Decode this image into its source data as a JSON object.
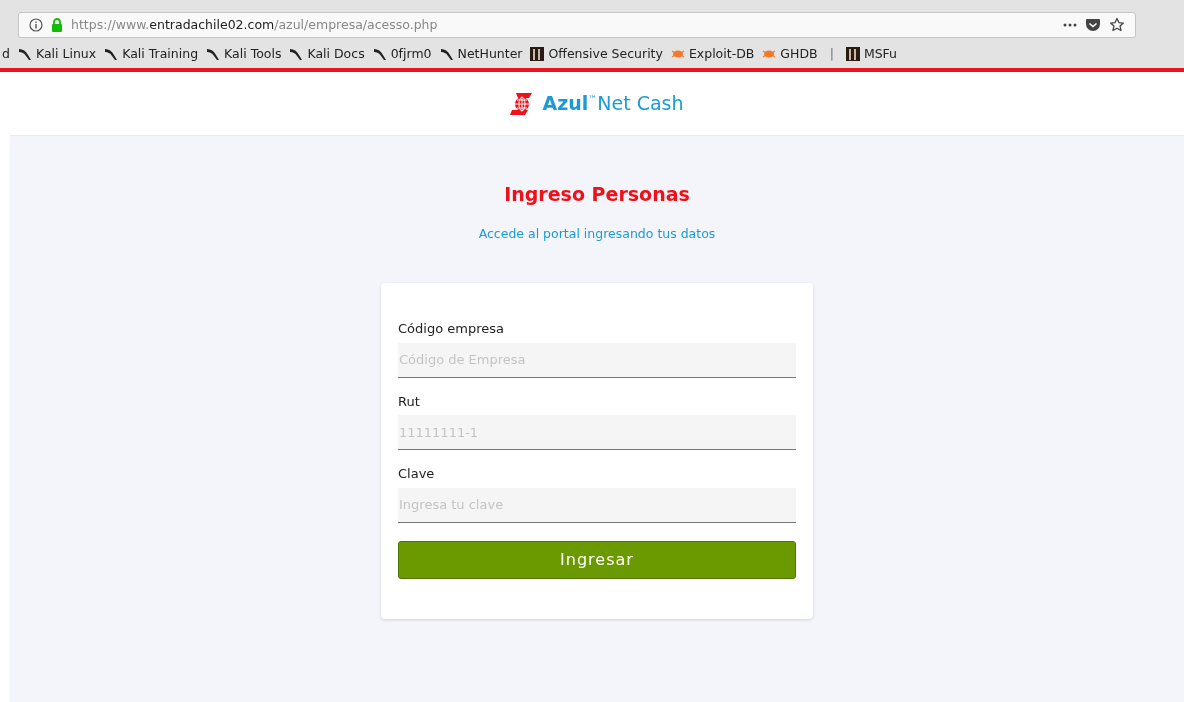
{
  "browser": {
    "url_prefix": "https://www.",
    "url_domain": "entradachile02.com",
    "url_path": "/azul/empresa/acesso.php",
    "bookmarks": [
      {
        "kind": "plain",
        "label": "d"
      },
      {
        "kind": "kali",
        "label": "Kali Linux"
      },
      {
        "kind": "kali",
        "label": "Kali Training"
      },
      {
        "kind": "kali",
        "label": "Kali Tools"
      },
      {
        "kind": "kali",
        "label": "Kali Docs"
      },
      {
        "kind": "kali",
        "label": "0fjrm0"
      },
      {
        "kind": "kali",
        "label": "NetHunter"
      },
      {
        "kind": "offsec",
        "label": "Offensive Security"
      },
      {
        "kind": "exploit",
        "label": "Exploit-DB"
      },
      {
        "kind": "exploit",
        "label": "GHDB"
      },
      {
        "kind": "separator",
        "label": "|"
      },
      {
        "kind": "offsec",
        "label": "MSFu"
      }
    ]
  },
  "header": {
    "brand": "Azul",
    "trademark": "™",
    "product": "Net Cash"
  },
  "title": "Ingreso Personas",
  "subtitle": "Accede al portal ingresando tus datos",
  "form": {
    "fields": [
      {
        "label": "Código empresa",
        "placeholder": "Código de Empresa"
      },
      {
        "label": "Rut",
        "placeholder": "11111111-1"
      },
      {
        "label": "Clave",
        "placeholder": "Ingresa tu clave"
      }
    ],
    "submit": "Ingresar"
  }
}
